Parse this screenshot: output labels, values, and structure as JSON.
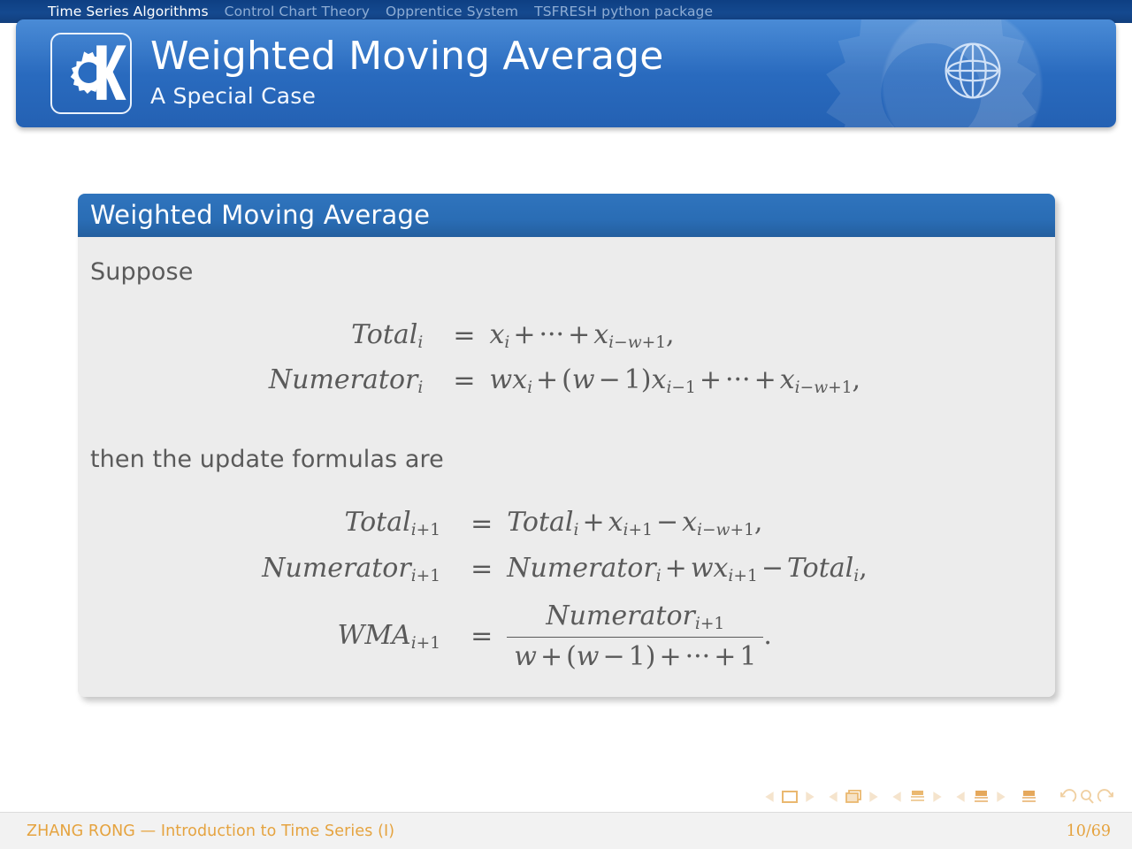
{
  "nav": {
    "items": [
      {
        "label": "Time Series Algorithms",
        "active": true
      },
      {
        "label": "Control Chart Theory",
        "active": false
      },
      {
        "label": "Opprentice System",
        "active": false
      },
      {
        "label": "TSFRESH python package",
        "active": false
      }
    ]
  },
  "header": {
    "title": "Weighted Moving Average",
    "subtitle": "A Special Case",
    "logo_icon": "kde-k-gear-logo",
    "globe_icon": "globe-icon",
    "bg_color": "#2a6cc0",
    "nav_bar_color": "#14498f"
  },
  "block": {
    "title": "Weighted Moving Average",
    "title_bar_color": "#2a6db5",
    "body_color": "#ececec",
    "intro_text": "Suppose",
    "middle_text": "then the update formulas are"
  },
  "equations": {
    "group1": [
      {
        "lhs_name": "Total",
        "lhs_sub": "i",
        "relation": "=",
        "rhs_plain": "x_i + ... + x_{i-w+1},"
      },
      {
        "lhs_name": "Numerator",
        "lhs_sub": "i",
        "relation": "=",
        "rhs_plain": "wx_i + (w-1)x_{i-1} + ... + x_{i-w+1},"
      }
    ],
    "group2": [
      {
        "lhs_name": "Total",
        "lhs_sub": "i+1",
        "relation": "=",
        "rhs_plain": "Total_i + x_{i+1} - x_{i-w+1},"
      },
      {
        "lhs_name": "Numerator",
        "lhs_sub": "i+1",
        "relation": "=",
        "rhs_plain": "Numerator_i + wx_{i+1} - Total_i,"
      },
      {
        "lhs_name": "WMA",
        "lhs_sub": "i+1",
        "relation": "=",
        "rhs_plain": "Numerator_{i+1} / (w + (w-1) + ... + 1)."
      }
    ],
    "symbols": {
      "plus": "+",
      "minus": "−",
      "equals": "=",
      "cdots": "···",
      "comma": ",",
      "period": ".",
      "lparen": "(",
      "rparen": ")",
      "x": "x",
      "w": "w",
      "one": "1",
      "i": "i",
      "total": "Total",
      "numerator": "Numerator",
      "wma": "WMA"
    }
  },
  "nav_symbols": {
    "icons": [
      "prev-slide-arrow",
      "slide-icon",
      "next-slide-arrow",
      "prev-frame-arrow",
      "frame-icon",
      "next-frame-arrow",
      "prev-subsection-arrow",
      "subsection-icon",
      "next-subsection-arrow",
      "prev-section-arrow",
      "section-icon",
      "next-section-arrow",
      "presentation-icon",
      "back-icon",
      "search-icon",
      "forward-icon"
    ],
    "color": "#f0cfa0"
  },
  "footer": {
    "left": "ZHANG RONG — Introduction to Time Series (I)",
    "page": "10/69",
    "text_color": "#e5a33f"
  }
}
